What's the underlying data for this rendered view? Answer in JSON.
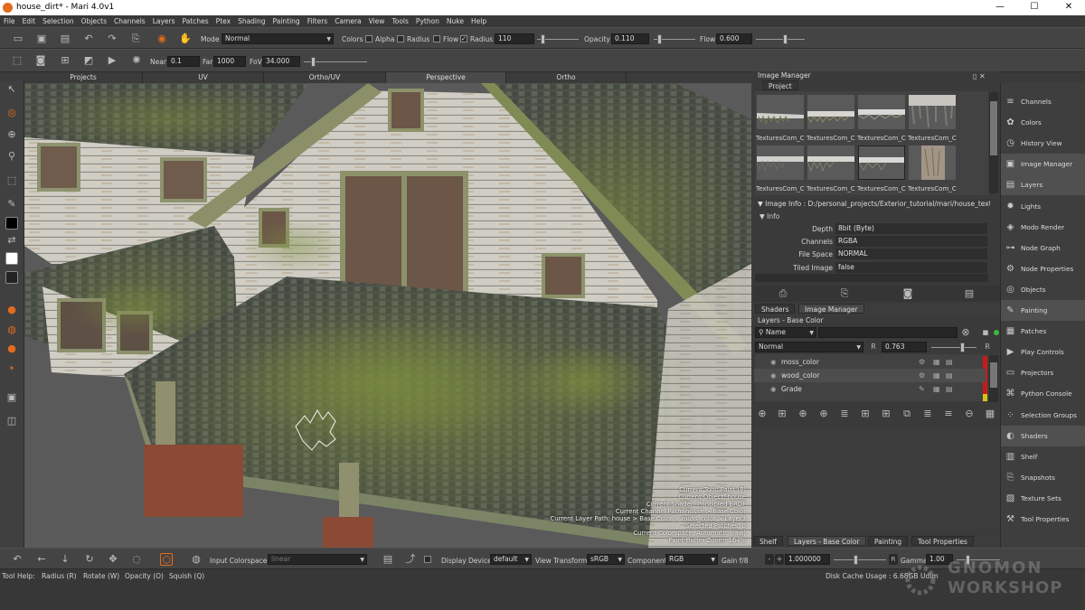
{
  "window": {
    "title": "house_dirt* - Mari 4.0v1",
    "minimize": "—",
    "maximize": "☐",
    "close": "✕"
  },
  "menu": [
    "File",
    "Edit",
    "Selection",
    "Objects",
    "Channels",
    "Layers",
    "Patches",
    "Ptex",
    "Shading",
    "Painting",
    "Filters",
    "Camera",
    "View",
    "Tools",
    "Python",
    "Nuke",
    "Help"
  ],
  "toolbar1": {
    "mode_label": "Mode",
    "mode_value": "Normal",
    "colors_label": "Colors",
    "alpha_label": "Alpha",
    "radius_label": "Radius",
    "flow_label": "Flow",
    "radius2_label": "Radius",
    "radius_value": "110",
    "opacity_label": "Opacity",
    "opacity_value": "0.110",
    "flow2_label": "Flow",
    "flow_value": "0.600"
  },
  "toolbar2": {
    "near_label": "Near",
    "near_value": "0.1",
    "far_label": "Far",
    "far_value": "1000",
    "fov_label": "FoV",
    "fov_value": "34.000"
  },
  "viewport_tabs": [
    "Projects",
    "UV",
    "Ortho/UV",
    "Perspective",
    "Ortho"
  ],
  "hud": [
    "Current Tool: Paint (P)",
    "Current Object: house",
    "Current Shader: Principled BRDF",
    "Current Channel Path: house > Base Color",
    "Current Layer Path: house > Base Color > moss_color > Layer3",
    "Selected Patches: 0",
    "Current Colorspace: Automatic (raw)",
    "Paint Buffer Zoom: 164%"
  ],
  "image_manager": {
    "title": "Image Manager",
    "tab": "Project",
    "thumbs": [
      "TexturesCom_C",
      "TexturesCom_C",
      "TexturesCom_C",
      "TexturesCom_C",
      "TexturesCom_C",
      "TexturesCom_C",
      "TexturesCom_C",
      "TexturesCom_C"
    ]
  },
  "image_info": {
    "header": "Image Info : D:/personal_projects/Exterior_tutorial/mari/house_textu",
    "section": "Info",
    "rows": [
      {
        "key": "Depth",
        "value": "8bit  (Byte)"
      },
      {
        "key": "Channels",
        "value": "RGBA"
      },
      {
        "key": "File Space",
        "value": "NORMAL"
      },
      {
        "key": "Tiled Image",
        "value": "false"
      }
    ]
  },
  "mid_tabs": [
    "Shaders",
    "Image Manager"
  ],
  "layers": {
    "title": "Layers - Base Color",
    "filter_label": "Name",
    "blend_mode": "Normal",
    "opacity": "0.763",
    "items": [
      "moss_color",
      "wood_color",
      "Grade"
    ]
  },
  "bottom_tabs": [
    "Shelf",
    "Layers - Base Color",
    "Painting",
    "Tool Properties"
  ],
  "right_panels": [
    {
      "label": "Channels",
      "icon": "channels-icon",
      "active": false
    },
    {
      "label": "Colors",
      "icon": "colors-icon",
      "active": false
    },
    {
      "label": "History View",
      "icon": "history-icon",
      "active": false
    },
    {
      "label": "Image Manager",
      "icon": "image-manager-icon",
      "active": true
    },
    {
      "label": "Layers",
      "icon": "layers-icon",
      "active": true
    },
    {
      "label": "Lights",
      "icon": "lights-icon",
      "active": false
    },
    {
      "label": "Modo Render",
      "icon": "modo-render-icon",
      "active": false
    },
    {
      "label": "Node Graph",
      "icon": "node-graph-icon",
      "active": false
    },
    {
      "label": "Node Properties",
      "icon": "node-properties-icon",
      "active": false
    },
    {
      "label": "Objects",
      "icon": "objects-icon",
      "active": false
    },
    {
      "label": "Painting",
      "icon": "painting-icon",
      "active": true
    },
    {
      "label": "Patches",
      "icon": "patches-icon",
      "active": false
    },
    {
      "label": "Play Controls",
      "icon": "play-controls-icon",
      "active": false
    },
    {
      "label": "Projectors",
      "icon": "projectors-icon",
      "active": false
    },
    {
      "label": "Python Console",
      "icon": "python-console-icon",
      "active": false
    },
    {
      "label": "Selection Groups",
      "icon": "selection-groups-icon",
      "active": false
    },
    {
      "label": "Shaders",
      "icon": "shaders-icon",
      "active": true
    },
    {
      "label": "Shelf",
      "icon": "shelf-icon",
      "active": false
    },
    {
      "label": "Snapshots",
      "icon": "snapshots-icon",
      "active": false
    },
    {
      "label": "Texture Sets",
      "icon": "texture-sets-icon",
      "active": false
    },
    {
      "label": "Tool Properties",
      "icon": "tool-properties-icon",
      "active": false
    }
  ],
  "bottom_bar": {
    "input_colorspace_label": "Input Colorspace",
    "input_colorspace_value": "linear",
    "display_device_label": "Display Device",
    "display_device_value": "default",
    "view_transform_label": "View Transform",
    "view_transform_value": "sRGB",
    "component_label": "Component",
    "component_value": "RGB",
    "gain_label": "Gain f/8",
    "gain_value": "1.000000",
    "gamma_label": "Gamma",
    "gamma_value": "1.00"
  },
  "status": {
    "tool_help": "Tool Help:",
    "hints": [
      "Radius (R)",
      "Rotate (W)",
      "Opacity (O)",
      "Squish (Q)"
    ],
    "disk_cache": "Disk Cache Usage : 6.68GB",
    "disk_cache_suffix": "Udim"
  },
  "watermark": "GNOMON WORKSHOP",
  "colors": {
    "accent": "#e36c1c",
    "layer_red": "#c91a1a",
    "layer_yellow": "#d6c21a"
  }
}
